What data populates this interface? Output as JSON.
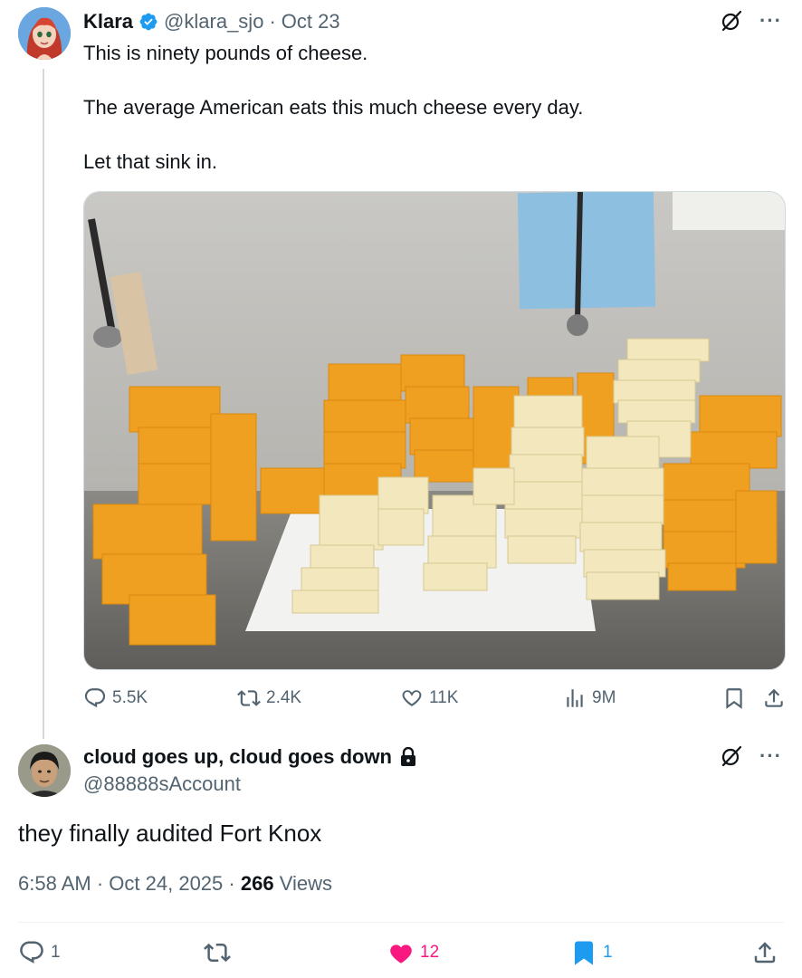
{
  "tweet": {
    "author_name": "Klara",
    "handle": "@klara_sjo",
    "separator": "·",
    "date": "Oct 23",
    "lines": [
      "This is ninety pounds of cheese.",
      "The average American eats this much cheese every day.",
      "Let that sink in."
    ],
    "stats": {
      "replies": "5.5K",
      "reposts": "2.4K",
      "likes": "11K",
      "views": "9M"
    }
  },
  "reply": {
    "author_name": "cloud goes up, cloud goes down",
    "handle": "@88888sAccount",
    "text": "they finally audited Fort Knox",
    "time": "6:58 AM",
    "date": "Oct 24, 2025",
    "separator": "·",
    "views_count": "266",
    "views_label": "Views",
    "stats": {
      "replies": "1",
      "likes": "12",
      "bookmarks": "1"
    }
  },
  "colors": {
    "text": "#0f1419",
    "secondary": "#536471",
    "verified": "#1d9bf0",
    "like": "#f91880",
    "bookmark": "#1d9bf0"
  },
  "icons": [
    "verified-badge-icon",
    "grok-icon",
    "more-icon",
    "lock-icon",
    "reply-icon",
    "repost-icon",
    "like-icon",
    "views-icon",
    "bookmark-icon",
    "share-icon"
  ]
}
